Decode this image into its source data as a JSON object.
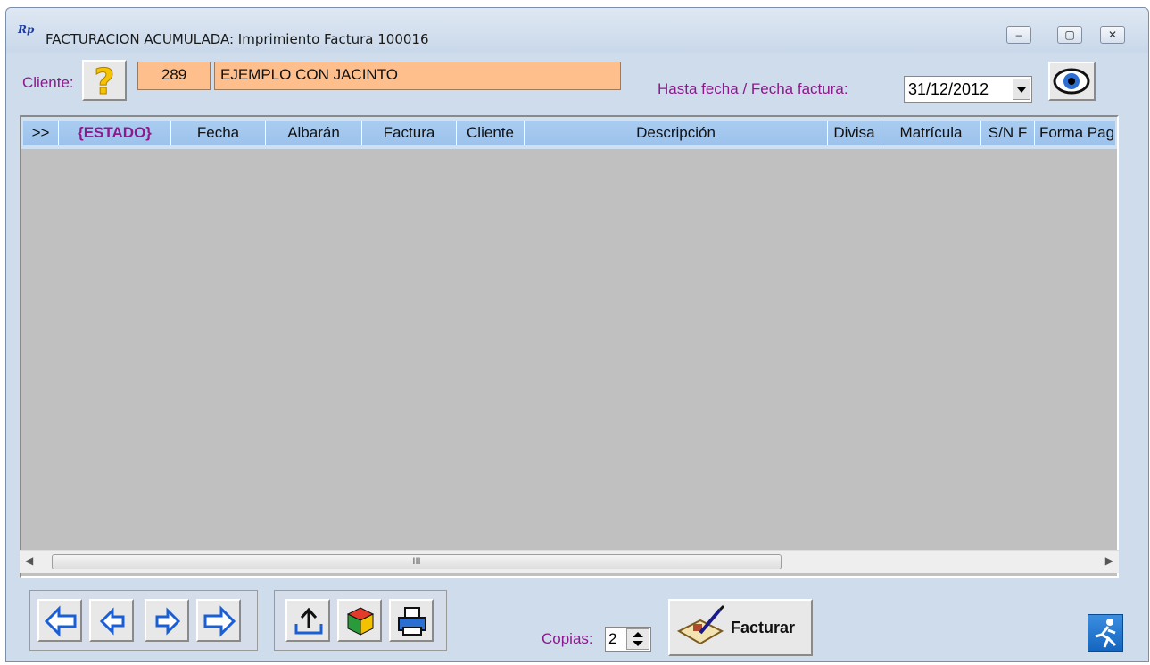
{
  "window": {
    "title": "FACTURACION ACUMULADA: Imprimiento Factura 100016",
    "logo_text": "Rp",
    "controls": [
      "minimize",
      "maximize",
      "close"
    ]
  },
  "header": {
    "cliente_label": "Cliente:",
    "cliente_code": "289",
    "cliente_name": "EJEMPLO CON JACINTO",
    "fecha_label": "Hasta fecha / Fecha factura:",
    "fecha_value": "31/12/2012"
  },
  "grid": {
    "columns": [
      ">>",
      "{ESTADO}",
      "Fecha",
      "Albarán",
      "Factura",
      "Cliente",
      "Descripción",
      "Divisa",
      "Matrícula",
      "S/N F",
      "Forma Pag"
    ],
    "rows": [],
    "scroll_thumb_text": "III"
  },
  "footer": {
    "copias_label": "Copias:",
    "copias_value": "2",
    "facturar_label": "Facturar"
  },
  "colors": {
    "accent_label": "#8b1a8b",
    "client_box": "#ffbf8c",
    "grid_bg": "#c0c0c0",
    "header_bg": "#9cc2ec"
  }
}
